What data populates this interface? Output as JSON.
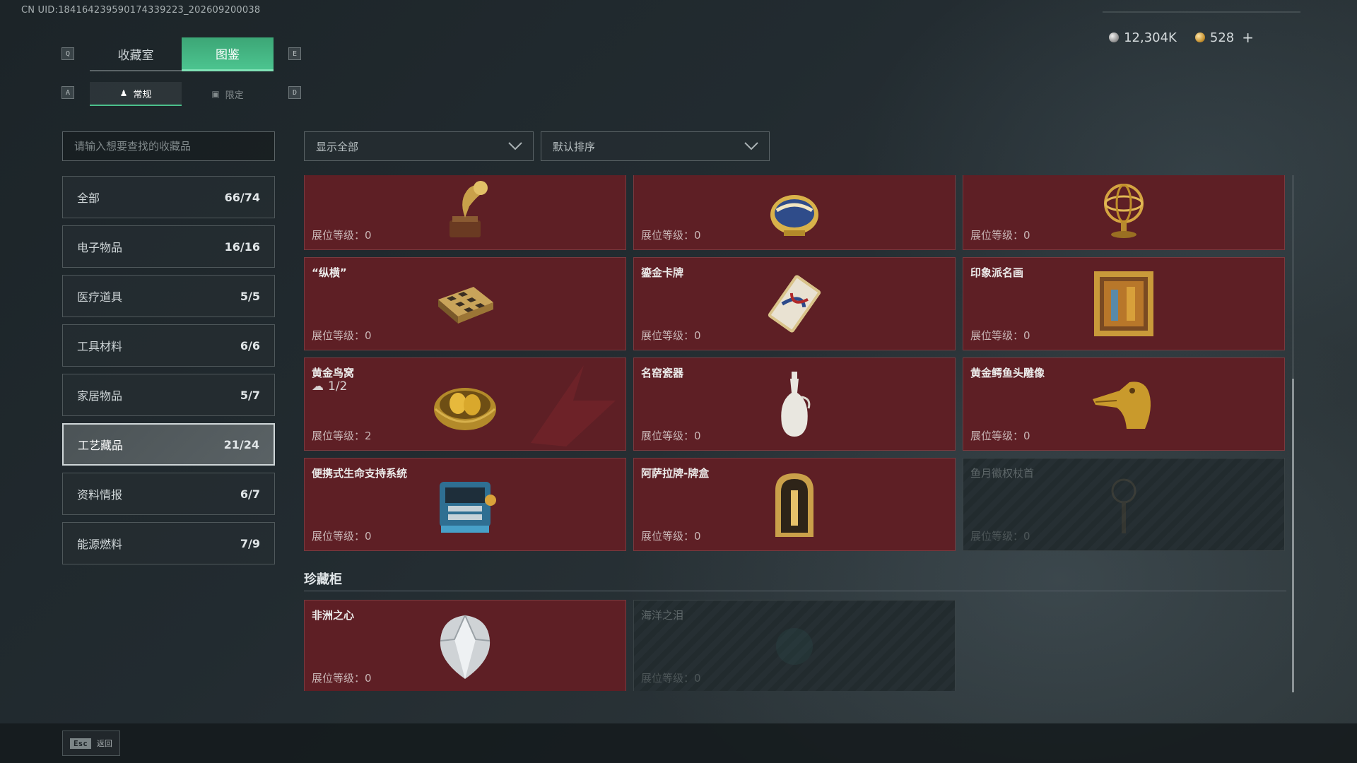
{
  "uid": "CN UID:1841642395901743392​23_202609200038",
  "currency": {
    "silver": "12,304K",
    "gold": "528",
    "plus": "+"
  },
  "keys": {
    "q": "Q",
    "e": "E",
    "a": "A",
    "d": "D"
  },
  "tabs": {
    "collection_room": "收藏室",
    "catalog": "图鉴"
  },
  "subtabs": {
    "regular": "常规",
    "limited": "限定"
  },
  "search": {
    "placeholder": "请输入想要查找的收藏品"
  },
  "categories": [
    {
      "label": "全部",
      "count": "66/74"
    },
    {
      "label": "电子物品",
      "count": "16/16"
    },
    {
      "label": "医疗道具",
      "count": "5/5"
    },
    {
      "label": "工具材料",
      "count": "6/6"
    },
    {
      "label": "家居物品",
      "count": "5/7"
    },
    {
      "label": "工艺藏品",
      "count": "21/24"
    },
    {
      "label": "资料情报",
      "count": "6/7"
    },
    {
      "label": "能源燃料",
      "count": "7/9"
    }
  ],
  "filters": {
    "show": "显示全部",
    "sort": "默认排序"
  },
  "level_prefix": "展位等级：",
  "cards": [
    {
      "name": "",
      "level": "0",
      "icon": "gramophone-icon"
    },
    {
      "name": "",
      "level": "0",
      "icon": "jeweled-egg-icon"
    },
    {
      "name": "",
      "level": "0",
      "icon": "armillary-sphere-icon"
    },
    {
      "name": "“纵横”",
      "level": "0",
      "icon": "chessboard-icon"
    },
    {
      "name": "鎏金卡牌",
      "level": "0",
      "icon": "gilded-card-icon"
    },
    {
      "name": "印象派名画",
      "level": "0",
      "icon": "painting-icon"
    },
    {
      "name": "黄金鸟窝",
      "level": "2",
      "icon": "golden-nest-icon",
      "sub": "1/2"
    },
    {
      "name": "名窑瓷器",
      "level": "0",
      "icon": "porcelain-vase-icon"
    },
    {
      "name": "黄金鳄鱼头雕像",
      "level": "0",
      "icon": "crocodile-statue-icon"
    },
    {
      "name": "便携式生命支持系统",
      "level": "0",
      "icon": "life-support-icon"
    },
    {
      "name": "阿萨拉牌-牌盒",
      "level": "0",
      "icon": "card-box-icon"
    },
    {
      "name": "鱼月徽权杖首",
      "level": "0",
      "icon": "scepter-head-icon",
      "locked": true
    }
  ],
  "section": {
    "title": "珍藏柜"
  },
  "cabinet_cards": [
    {
      "name": "非洲之心",
      "level": "0",
      "icon": "diamond-icon"
    },
    {
      "name": "海洋之泪",
      "level": "0",
      "icon": "gem-icon",
      "locked": true
    }
  ],
  "footer": {
    "esc": "Esc",
    "back": "返回"
  }
}
